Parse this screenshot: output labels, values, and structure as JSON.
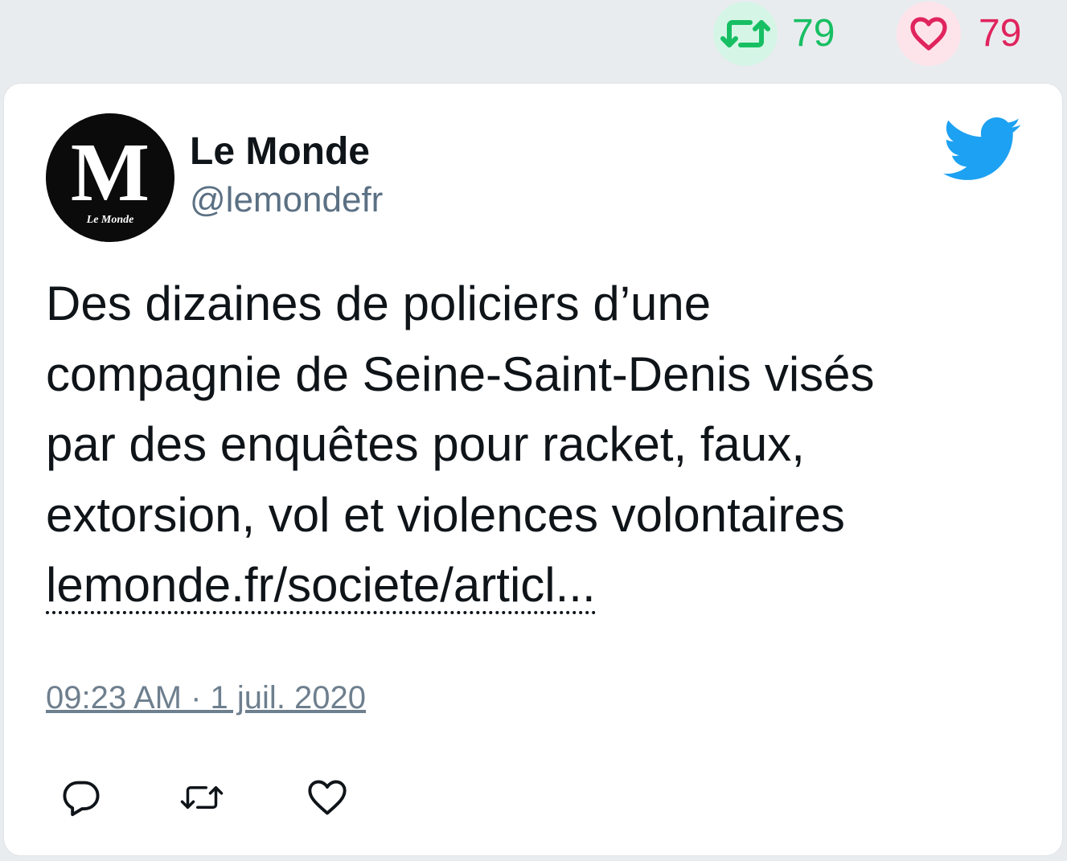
{
  "stats": {
    "retweet_count": "79",
    "like_count": "79",
    "retweet_color": "#17bf63",
    "like_color": "#e0245e",
    "retweet_icon": "retweet-icon",
    "like_icon": "heart-icon"
  },
  "tweet": {
    "author_name": "Le Monde",
    "author_handle": "@lemondefr",
    "avatar_logo_text": "Le Monde",
    "text_lines": [
      "Des dizaines de policiers d’une",
      "compagnie de Seine-Saint-Denis visés",
      "par des enquêtes pour racket, faux,",
      "extorsion, vol et violences volontaires"
    ],
    "link_text": "lemonde.fr/societe/articl...",
    "timestamp": "09:23 AM · 1 juil. 2020",
    "brand_icon": "twitter-bird-icon",
    "brand_color": "#1da1f2"
  },
  "actions": {
    "items": [
      "reply-icon",
      "retweet-icon",
      "heart-icon"
    ]
  }
}
